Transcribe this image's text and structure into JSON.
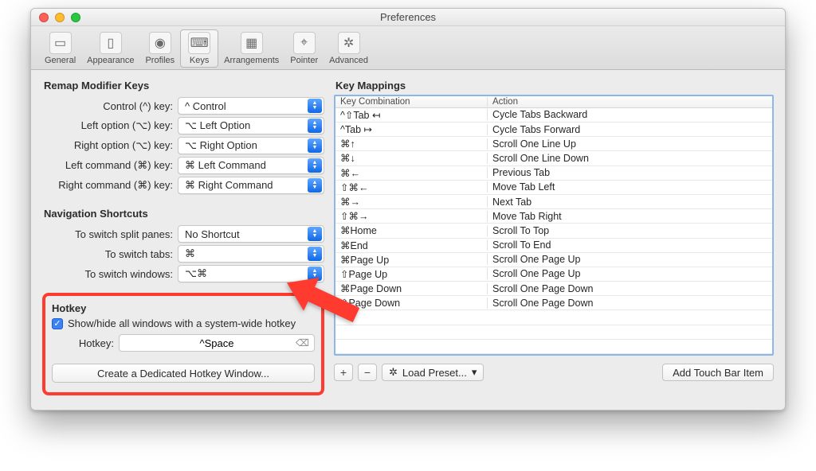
{
  "window": {
    "title": "Preferences"
  },
  "toolbar": {
    "items": [
      {
        "label": "General"
      },
      {
        "label": "Appearance"
      },
      {
        "label": "Profiles"
      },
      {
        "label": "Keys",
        "active": true
      },
      {
        "label": "Arrangements"
      },
      {
        "label": "Pointer"
      },
      {
        "label": "Advanced"
      }
    ]
  },
  "remap": {
    "title": "Remap Modifier Keys",
    "rows": [
      {
        "label": "Control (^) key:",
        "value": "^ Control"
      },
      {
        "label": "Left option (⌥) key:",
        "value": "⌥ Left Option"
      },
      {
        "label": "Right option (⌥) key:",
        "value": "⌥ Right Option"
      },
      {
        "label": "Left command (⌘) key:",
        "value": "⌘ Left Command"
      },
      {
        "label": "Right command (⌘) key:",
        "value": "⌘ Right Command"
      }
    ]
  },
  "nav": {
    "title": "Navigation Shortcuts",
    "rows": [
      {
        "label": "To switch split panes:",
        "value": "No Shortcut"
      },
      {
        "label": "To switch tabs:",
        "value": "⌘"
      },
      {
        "label": "To switch windows:",
        "value": "⌥⌘"
      }
    ]
  },
  "hotkey": {
    "title": "Hotkey",
    "checkbox_label": "Show/hide all windows with a system-wide hotkey",
    "checked": true,
    "field_label": "Hotkey:",
    "field_value": "^Space",
    "create_button": "Create a Dedicated Hotkey Window..."
  },
  "keymap": {
    "title": "Key Mappings",
    "headers": {
      "combo": "Key Combination",
      "action": "Action"
    },
    "rows": [
      {
        "combo": "^⇧Tab ↤",
        "action": "Cycle Tabs Backward"
      },
      {
        "combo": "^Tab ↦",
        "action": "Cycle Tabs Forward"
      },
      {
        "combo": "⌘↑",
        "action": "Scroll One Line Up"
      },
      {
        "combo": "⌘↓",
        "action": "Scroll One Line Down"
      },
      {
        "combo": "⌘←",
        "action": "Previous Tab"
      },
      {
        "combo": "⇧⌘←",
        "action": "Move Tab Left"
      },
      {
        "combo": "⌘→",
        "action": "Next Tab"
      },
      {
        "combo": "⇧⌘→",
        "action": "Move Tab Right"
      },
      {
        "combo": "⌘Home",
        "action": "Scroll To Top"
      },
      {
        "combo": "⌘End",
        "action": "Scroll To End"
      },
      {
        "combo": "⌘Page Up",
        "action": "Scroll One Page Up"
      },
      {
        "combo": "⇧Page Up",
        "action": "Scroll One Page Up"
      },
      {
        "combo": "⌘Page Down",
        "action": "Scroll One Page Down"
      },
      {
        "combo": "⇧Page Down",
        "action": "Scroll One Page Down"
      }
    ],
    "add": "+",
    "remove": "−",
    "load_preset": "Load Preset...",
    "touchbar": "Add Touch Bar Item"
  }
}
